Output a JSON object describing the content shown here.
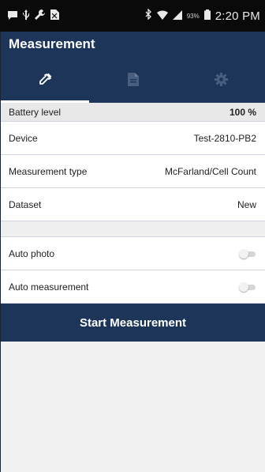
{
  "status_bar": {
    "battery_percent": "93%",
    "time": "2:20 PM",
    "icons_left": [
      "message-icon",
      "usb-icon",
      "wrench-icon",
      "no-sim-icon"
    ],
    "icons_right": [
      "bluetooth-icon",
      "wifi-icon",
      "signal-icon",
      "battery-icon"
    ]
  },
  "app_bar": {
    "title": "Measurement"
  },
  "tabs": [
    {
      "icon": "pipette-icon",
      "active": true
    },
    {
      "icon": "document-icon",
      "active": false
    },
    {
      "icon": "gear-icon",
      "active": false
    }
  ],
  "battery": {
    "label": "Battery level",
    "value": "100 %"
  },
  "device": {
    "label": "Device",
    "value": "Test-2810-PB2"
  },
  "measurement_type": {
    "label": "Measurement type",
    "value": "McFarland/Cell Count"
  },
  "dataset": {
    "label": "Dataset",
    "value": "New"
  },
  "auto_photo": {
    "label": "Auto photo",
    "enabled": false
  },
  "auto_measurement": {
    "label": "Auto measurement",
    "enabled": false
  },
  "start_button": {
    "label": "Start Measurement"
  },
  "colors": {
    "primary": "#1d3558",
    "background": "#f1f1f1",
    "status_bar": "#0a0a0a",
    "inactive_tab_icon": "#4a5f7f"
  }
}
